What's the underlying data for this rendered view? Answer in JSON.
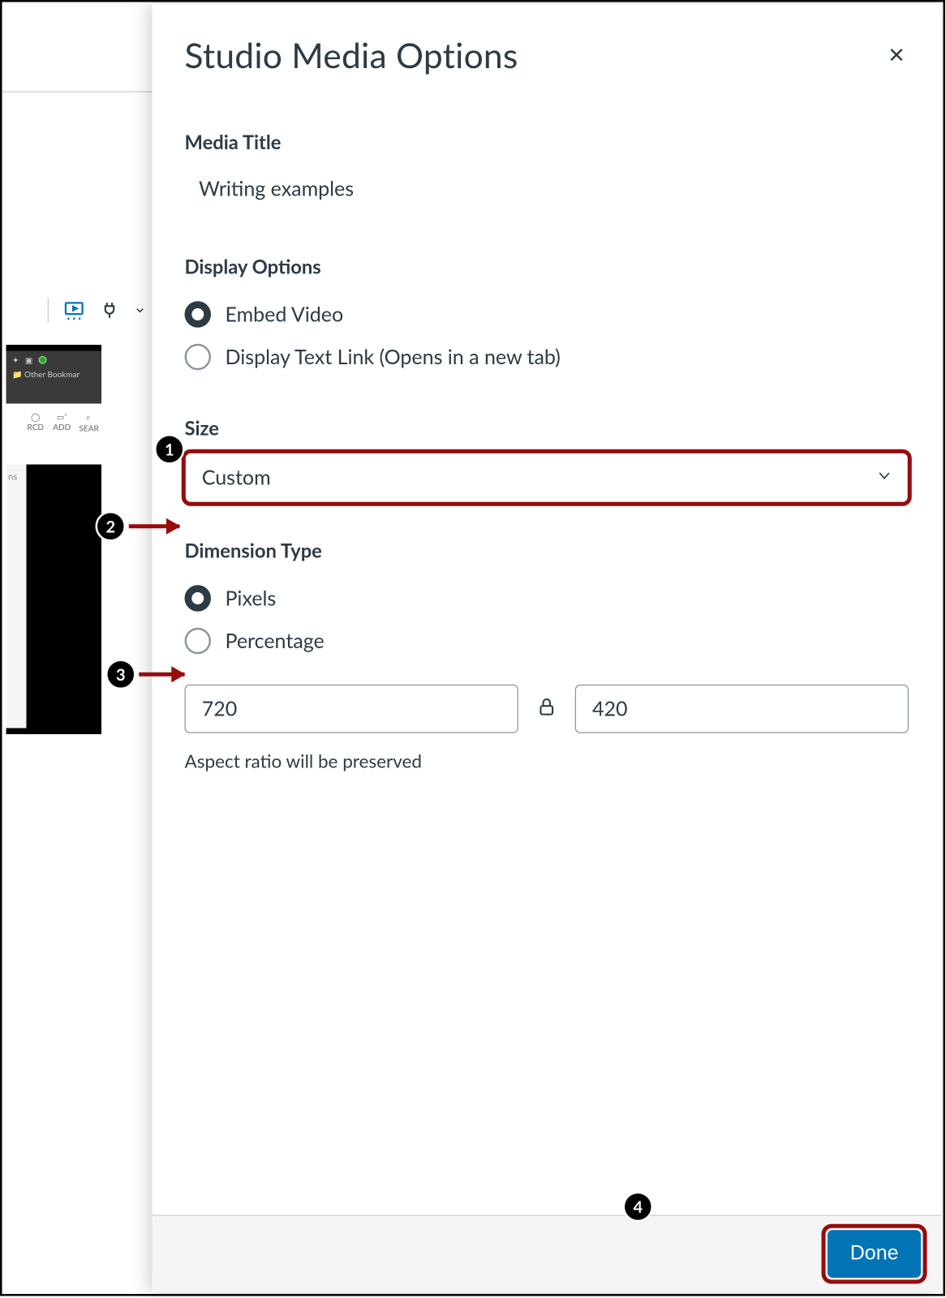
{
  "panel": {
    "title": "Studio Media Options",
    "media_title_label": "Media Title",
    "media_title_value": "Writing examples",
    "display_options_label": "Display Options",
    "display_options": {
      "embed": "Embed Video",
      "text_link": "Display Text Link (Opens in a new tab)"
    },
    "size_label": "Size",
    "size_select_value": "Custom",
    "dimension_type_label": "Dimension Type",
    "dimension_type": {
      "pixels": "Pixels",
      "percentage": "Percentage"
    },
    "width_value": "720",
    "height_value": "420",
    "aspect_note": "Aspect ratio will be preserved",
    "done_label": "Done"
  },
  "background": {
    "bookmarks_label": "Other Bookmar",
    "icon_add": "ADD",
    "icon_record": "RCD",
    "icon_search": "SEAR",
    "side_label": "ns"
  },
  "annotations": {
    "c1": "1",
    "c2": "2",
    "c3": "3",
    "c4": "4"
  }
}
